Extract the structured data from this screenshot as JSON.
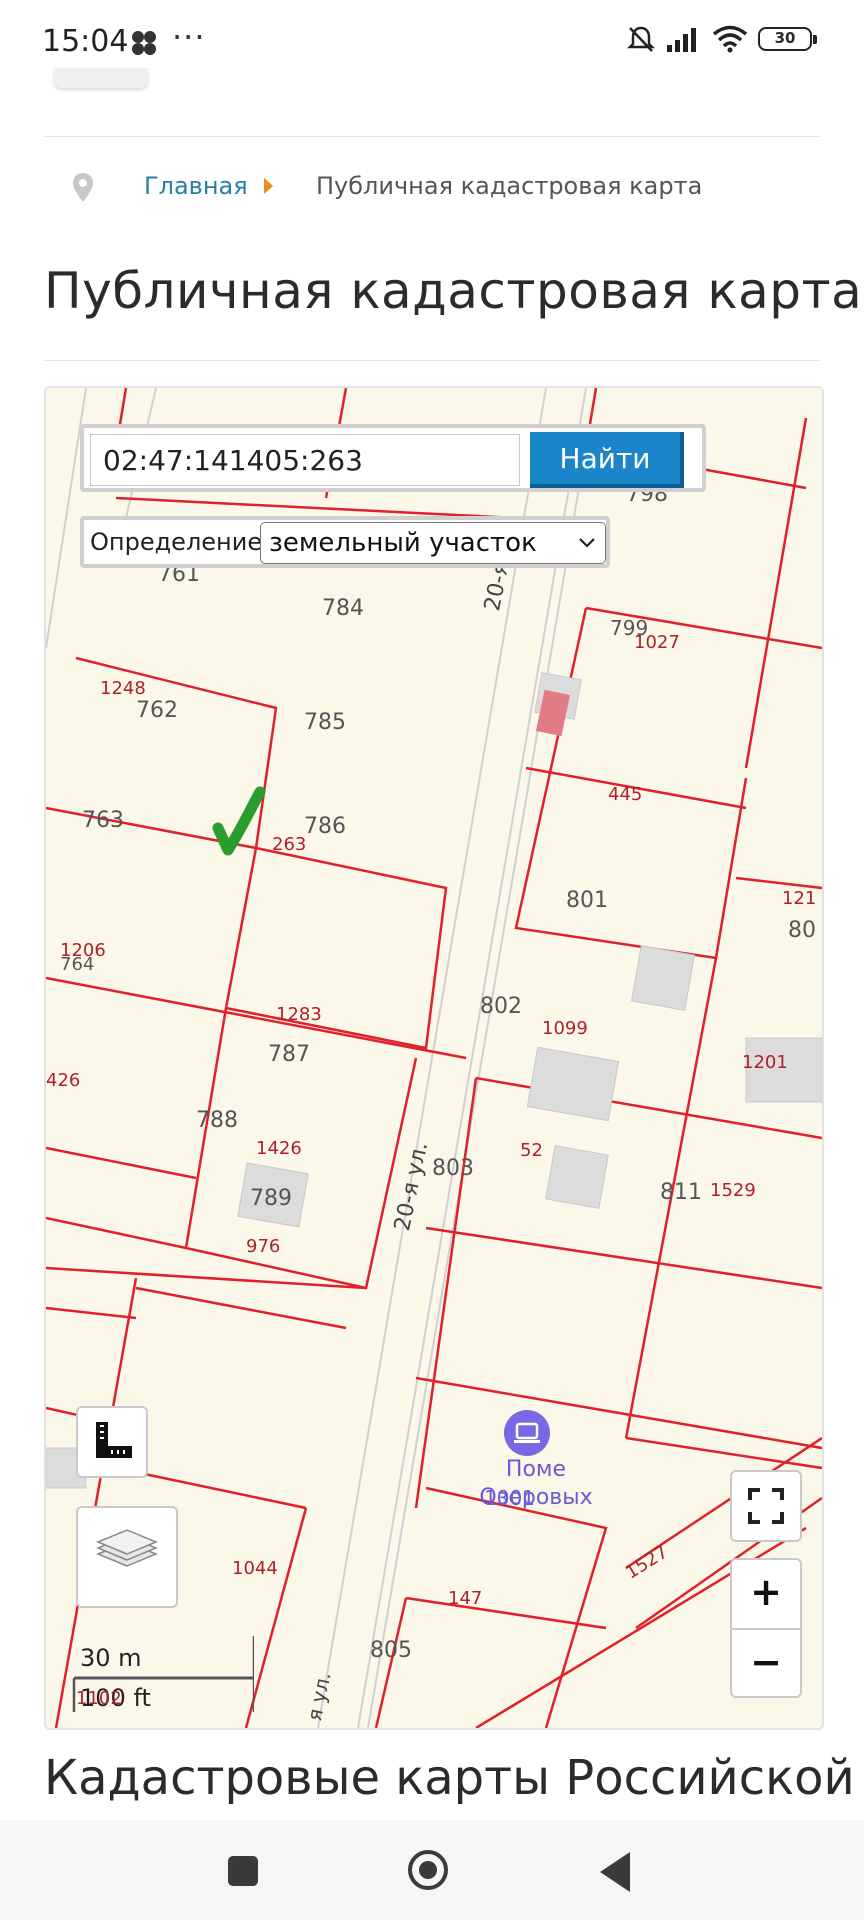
{
  "status_bar": {
    "time": "15:04",
    "more": "···",
    "battery": "30"
  },
  "breadcrumb": {
    "home": "Главная",
    "current": "Публичная кадастровая карта"
  },
  "page_title": "Публичная кадастровая карта",
  "search": {
    "value": "02:47:141405:263",
    "button": "Найти"
  },
  "definition": {
    "label": "Определение:",
    "selected": "земельный участок"
  },
  "map": {
    "parcel_labels": [
      "761",
      "784",
      "798",
      "762",
      "1248",
      "785",
      "799",
      "1027",
      "445",
      "763",
      "786",
      "263",
      "801",
      "121",
      "80",
      "1206",
      "764",
      "802",
      "1099",
      "1283",
      "787",
      "1201",
      "426",
      "788",
      "1426",
      "52",
      "803",
      "811",
      "1529",
      "789",
      "976",
      "1001",
      "1044",
      "147",
      "1527",
      "805",
      "1102"
    ],
    "street_labels": [
      "20-я ул.",
      "20-я ул.",
      "я ул."
    ],
    "poi": "Поме Озеровых",
    "scale_metric": "30 m",
    "scale_imperial": "100 ft",
    "zoom_in": "+",
    "zoom_out": "−"
  },
  "section_title": "Кадастровые карты Российской",
  "colors": {
    "accent": "#1b85c9",
    "link": "#2a7fa5",
    "parcel_border": "#e0202a",
    "map_bg": "#fbf8ea"
  },
  "icons": [
    "location-pin-icon",
    "ruler-icon",
    "layers-icon",
    "fullscreen-icon",
    "checkmark-icon"
  ]
}
